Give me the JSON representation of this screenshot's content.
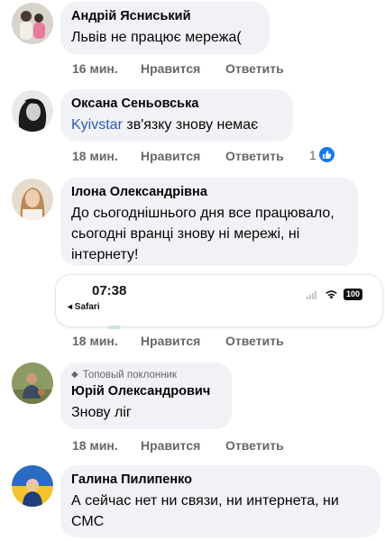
{
  "comments": [
    {
      "author": "Андрій Ясниський",
      "text": "Львів не працює мережа(",
      "time": "16 мин.",
      "like": "Нравится",
      "reply": "Ответить"
    },
    {
      "author": "Оксана Сеньовська",
      "mention": "Kyivstar",
      "text": " зв'язку знову немає",
      "time": "18 мин.",
      "like": "Нравится",
      "reply": "Ответить",
      "reaction_count": "1"
    },
    {
      "author": "Ілона Олександрівна",
      "text": "До сьогоднішнього дня все працювало, сьогодні вранці знову ні мережі, ні інтернету!",
      "time": "18 мин.",
      "like": "Нравится",
      "reply": "Ответить",
      "attachment": {
        "clock": "07:38",
        "app": "◂ Safari",
        "battery": "100"
      }
    },
    {
      "badge": "Топовый поклонник",
      "author": "Юрій Олександрович",
      "text": "Знову ліг",
      "time": "18 мин.",
      "like": "Нравится",
      "reply": "Ответить"
    },
    {
      "author": "Галина Пилипенко",
      "text": "А сейчас нет ни связи, ни интернета, ни СМС"
    }
  ],
  "icons": {
    "reaction": "like-thumb-icon",
    "badge": "diamond-icon",
    "wifi": "wifi-icon",
    "signal": "signal-icon"
  },
  "colors": {
    "bubble": "#f0f2f5",
    "meta": "#65676b",
    "mention": "#2a5bb8",
    "like_blue": "#1877f2"
  }
}
